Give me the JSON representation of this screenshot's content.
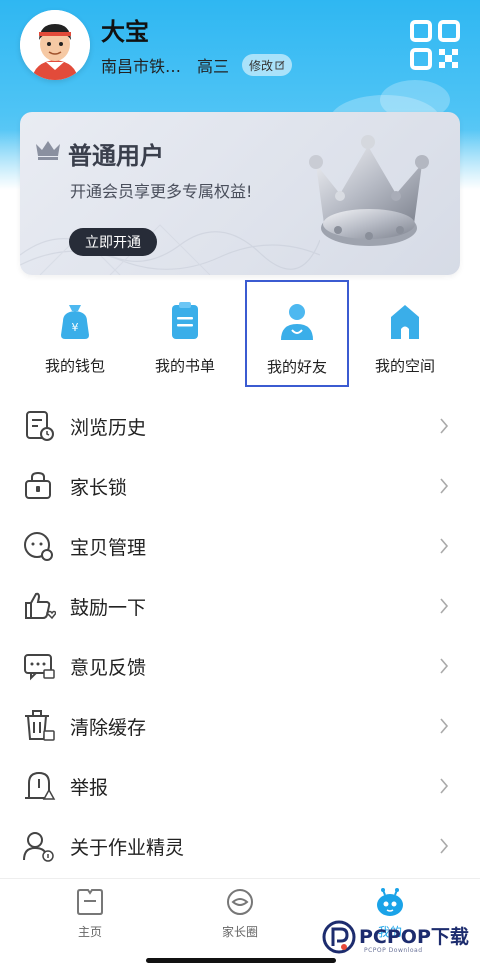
{
  "profile": {
    "name": "大宝",
    "school": "南昌市铁…",
    "grade": "高三",
    "edit_label": "修改"
  },
  "vip_card": {
    "title": "普通用户",
    "subtitle": "开通会员享更多专属权益!",
    "button_label": "立即开通"
  },
  "quick_actions": [
    {
      "label": "我的钱包",
      "icon": "wallet-icon"
    },
    {
      "label": "我的书单",
      "icon": "booklist-icon"
    },
    {
      "label": "我的好友",
      "icon": "friend-icon",
      "selected": true
    },
    {
      "label": "我的空间",
      "icon": "space-icon"
    }
  ],
  "menu": [
    {
      "label": "浏览历史",
      "icon": "history-icon"
    },
    {
      "label": "家长锁",
      "icon": "parent-lock-icon"
    },
    {
      "label": "宝贝管理",
      "icon": "child-manage-icon"
    },
    {
      "label": "鼓励一下",
      "icon": "thumbs-up-icon"
    },
    {
      "label": "意见反馈",
      "icon": "feedback-icon"
    },
    {
      "label": "清除缓存",
      "icon": "trash-icon"
    },
    {
      "label": "举报",
      "icon": "report-icon"
    },
    {
      "label": "关于作业精灵",
      "icon": "about-icon"
    }
  ],
  "tabs": [
    {
      "label": "主页",
      "icon": "home-icon"
    },
    {
      "label": "家长圈",
      "icon": "parent-circle-icon"
    },
    {
      "label": "我的",
      "icon": "mine-icon",
      "active": true
    }
  ],
  "watermark": {
    "text": "PCPOP下载",
    "sub": "PCPOP Download"
  },
  "colors": {
    "header_blue": "#2fb7f2",
    "accent_blue": "#1aa3e8",
    "selection_border": "#3b5bd1",
    "vip_button_bg": "#272c38"
  }
}
